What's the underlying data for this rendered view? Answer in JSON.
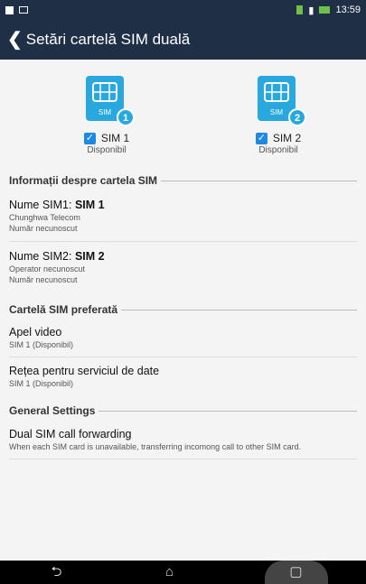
{
  "status_bar": {
    "time": "13:59"
  },
  "app_bar": {
    "title": "Setări cartelă SIM duală"
  },
  "sims": [
    {
      "badge": "1",
      "chip_label": "SIM",
      "name": "SIM 1",
      "status": "Disponibil",
      "checked": true
    },
    {
      "badge": "2",
      "chip_label": "SIM",
      "name": "SIM 2",
      "status": "Disponibil",
      "checked": true
    }
  ],
  "sections": {
    "sim_info": "Informații despre cartela SIM",
    "preferred_sim": "Cartelă SIM preferată",
    "general": "General Settings"
  },
  "sim_info_items": [
    {
      "label_prefix": "Nume SIM1: ",
      "label_bold": "SIM 1",
      "line1": "Chunghwa Telecom",
      "line2": "Număr necunoscut"
    },
    {
      "label_prefix": "Nume SIM2: ",
      "label_bold": "SIM 2",
      "line1": "Operator necunoscut",
      "line2": "Număr necunoscut"
    }
  ],
  "preferred_items": [
    {
      "title": "Apel video",
      "subtitle": "SIM 1 (Disponibil)"
    },
    {
      "title": "Rețea pentru serviciul de date",
      "subtitle": "SIM 1 (Disponibil)"
    }
  ],
  "general_items": [
    {
      "title": "Dual SIM call forwarding",
      "subtitle": "When each SIM card is unavailable, transferring incomong call to other SIM card."
    }
  ],
  "nav": {
    "back": "⮌",
    "home": "⌂",
    "recent": "▢"
  },
  "colors": {
    "header_bg": "#1f2f45",
    "accent": "#1e88e5",
    "sim_icon": "#29a8e0"
  }
}
